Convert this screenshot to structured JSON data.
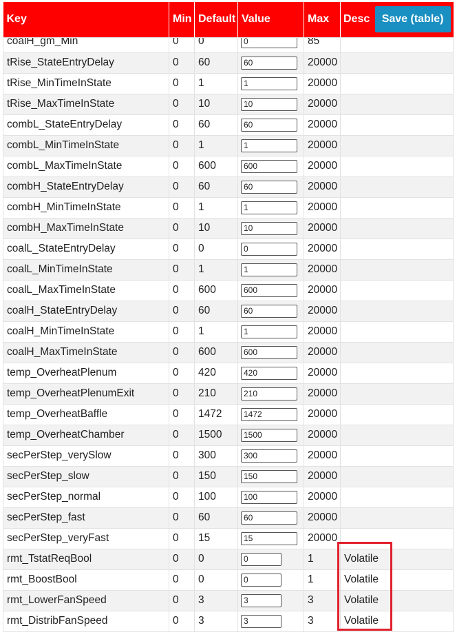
{
  "table": {
    "headers": {
      "key": "Key",
      "min": "Min",
      "default": "Default",
      "value": "Value",
      "max": "Max",
      "desc": "Desc"
    },
    "save_label": "Save (table)",
    "rows": [
      {
        "key": "coalH_gm_Min",
        "min": "0",
        "default": "0",
        "value": "0",
        "max": "85",
        "desc": ""
      },
      {
        "key": "tRise_StateEntryDelay",
        "min": "0",
        "default": "60",
        "value": "60",
        "max": "20000",
        "desc": ""
      },
      {
        "key": "tRise_MinTimeInState",
        "min": "0",
        "default": "1",
        "value": "1",
        "max": "20000",
        "desc": ""
      },
      {
        "key": "tRise_MaxTimeInState",
        "min": "0",
        "default": "10",
        "value": "10",
        "max": "20000",
        "desc": ""
      },
      {
        "key": "combL_StateEntryDelay",
        "min": "0",
        "default": "60",
        "value": "60",
        "max": "20000",
        "desc": ""
      },
      {
        "key": "combL_MinTimeInState",
        "min": "0",
        "default": "1",
        "value": "1",
        "max": "20000",
        "desc": ""
      },
      {
        "key": "combL_MaxTimeInState",
        "min": "0",
        "default": "600",
        "value": "600",
        "max": "20000",
        "desc": ""
      },
      {
        "key": "combH_StateEntryDelay",
        "min": "0",
        "default": "60",
        "value": "60",
        "max": "20000",
        "desc": ""
      },
      {
        "key": "combH_MinTimeInState",
        "min": "0",
        "default": "1",
        "value": "1",
        "max": "20000",
        "desc": ""
      },
      {
        "key": "combH_MaxTimeInState",
        "min": "0",
        "default": "10",
        "value": "10",
        "max": "20000",
        "desc": ""
      },
      {
        "key": "coalL_StateEntryDelay",
        "min": "0",
        "default": "0",
        "value": "0",
        "max": "20000",
        "desc": ""
      },
      {
        "key": "coalL_MinTimeInState",
        "min": "0",
        "default": "1",
        "value": "1",
        "max": "20000",
        "desc": ""
      },
      {
        "key": "coalL_MaxTimeInState",
        "min": "0",
        "default": "600",
        "value": "600",
        "max": "20000",
        "desc": ""
      },
      {
        "key": "coalH_StateEntryDelay",
        "min": "0",
        "default": "60",
        "value": "60",
        "max": "20000",
        "desc": ""
      },
      {
        "key": "coalH_MinTimeInState",
        "min": "0",
        "default": "1",
        "value": "1",
        "max": "20000",
        "desc": ""
      },
      {
        "key": "coalH_MaxTimeInState",
        "min": "0",
        "default": "600",
        "value": "600",
        "max": "20000",
        "desc": ""
      },
      {
        "key": "temp_OverheatPlenum",
        "min": "0",
        "default": "420",
        "value": "420",
        "max": "20000",
        "desc": ""
      },
      {
        "key": "temp_OverheatPlenumExit",
        "min": "0",
        "default": "210",
        "value": "210",
        "max": "20000",
        "desc": ""
      },
      {
        "key": "temp_OverheatBaffle",
        "min": "0",
        "default": "1472",
        "value": "1472",
        "max": "20000",
        "desc": ""
      },
      {
        "key": "temp_OverheatChamber",
        "min": "0",
        "default": "1500",
        "value": "1500",
        "max": "20000",
        "desc": ""
      },
      {
        "key": "secPerStep_verySlow",
        "min": "0",
        "default": "300",
        "value": "300",
        "max": "20000",
        "desc": ""
      },
      {
        "key": "secPerStep_slow",
        "min": "0",
        "default": "150",
        "value": "150",
        "max": "20000",
        "desc": ""
      },
      {
        "key": "secPerStep_normal",
        "min": "0",
        "default": "100",
        "value": "100",
        "max": "20000",
        "desc": ""
      },
      {
        "key": "secPerStep_fast",
        "min": "0",
        "default": "60",
        "value": "60",
        "max": "20000",
        "desc": ""
      },
      {
        "key": "secPerStep_veryFast",
        "min": "0",
        "default": "15",
        "value": "15",
        "max": "20000",
        "desc": ""
      },
      {
        "key": "rmt_TstatReqBool",
        "min": "0",
        "default": "0",
        "value": "0",
        "max": "1",
        "desc": "Volatile"
      },
      {
        "key": "rmt_BoostBool",
        "min": "0",
        "default": "0",
        "value": "0",
        "max": "1",
        "desc": "Volatile"
      },
      {
        "key": "rmt_LowerFanSpeed",
        "min": "0",
        "default": "3",
        "value": "3",
        "max": "3",
        "desc": "Volatile"
      },
      {
        "key": "rmt_DistribFanSpeed",
        "min": "0",
        "default": "3",
        "value": "3",
        "max": "3",
        "desc": "Volatile"
      }
    ]
  },
  "colors": {
    "header_bg": "#ff0000",
    "save_button_bg": "#1a8fc1",
    "highlight_border": "#e0202c",
    "row_alt_bg": "#f2f2f2"
  }
}
